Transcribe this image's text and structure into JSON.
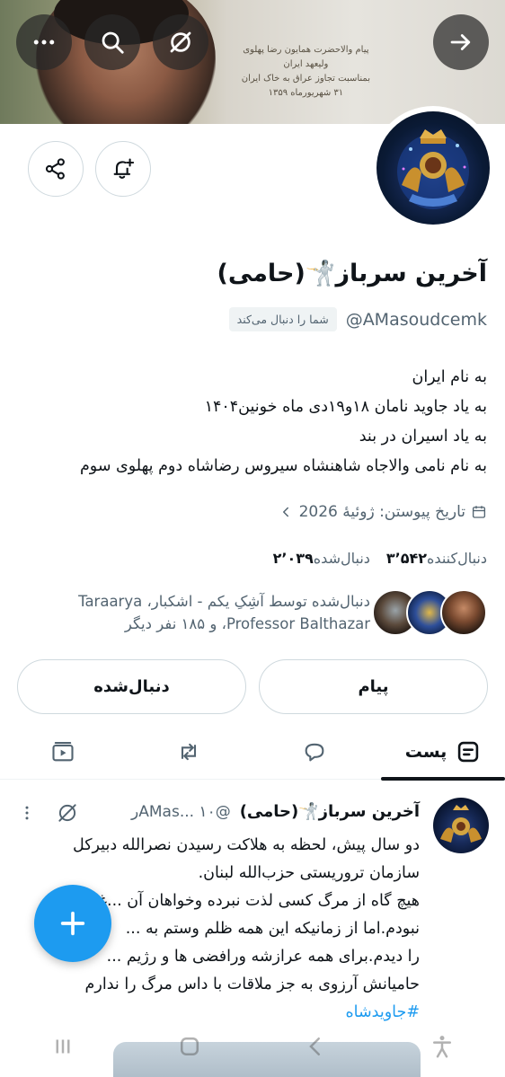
{
  "banner": {
    "paper_lines": [
      "پیام والاحضرت همایون رضا پهلوی",
      "ولیعهد ایران",
      "بمناسبت تجاوز عراق به خاک ایران",
      "۳۱ شهریورماه ۱۳۵۹"
    ]
  },
  "header_icons": {
    "more": "more-icon",
    "search": "search-icon",
    "grok": "grok-icon",
    "forward": "arrow-right-icon"
  },
  "profile": {
    "name": "آخرین سرباز🤺(حامی)",
    "handle": "@AMasoudcemk",
    "follows_you": "شما را دنبال می‌کند",
    "bio": [
      "به نام ایران",
      "به یاد جاوید نامان ۱۸و۱۹دی ماه خونین۱۴۰۴",
      "به یاد اسیران در بند",
      "به نام نامی والاجاه شاهنشاه سیروس رضاشاه دوم پهلوی سوم"
    ],
    "joined": "تاریخ پیوستن: ژوئیهٔ 2026",
    "following_count": "۲٬۰۳۹",
    "following_label": "دنبال‌شده",
    "followers_count": "۳٬۵۴۲",
    "followers_label": "دنبال‌کننده",
    "followed_by_line1": "دنبال‌شده توسط آشِکِ یکم - اشکبار، Taraarya",
    "followed_by_line2": "Professor Balthazar، و ۱۸۵ نفر دیگر"
  },
  "buttons": {
    "message": "پیام",
    "following": "دنبال‌شده"
  },
  "tabs": {
    "posts": "پست"
  },
  "post": {
    "name": "آخرین سرباز🤺(حامی)",
    "handle_time": "@AMas... ۱۰ر",
    "body": [
      "دو سال پیش، لحظه به هلاکت رسیدن نصرالله دبیرکل",
      "سازمان تروریستی حزب‌الله لبنان.",
      "هیچ گاه از مرگ کسی لذت نبرده وخواهان آن ...غیر",
      "نبودم.اما از زمانیکه این همه ظلم وستم به ...",
      "را دیدم.برای همه عرازشه ورافضی ها و رژیم ...",
      "حامیانش آرزوی به جز ملاقات با داس مرگ را ندارم"
    ],
    "hashtag": "#جاویدشاه"
  },
  "colors": {
    "accent": "#1d9bf0",
    "text": "#0f1419",
    "muted": "#536471",
    "border": "#cfd9de"
  }
}
